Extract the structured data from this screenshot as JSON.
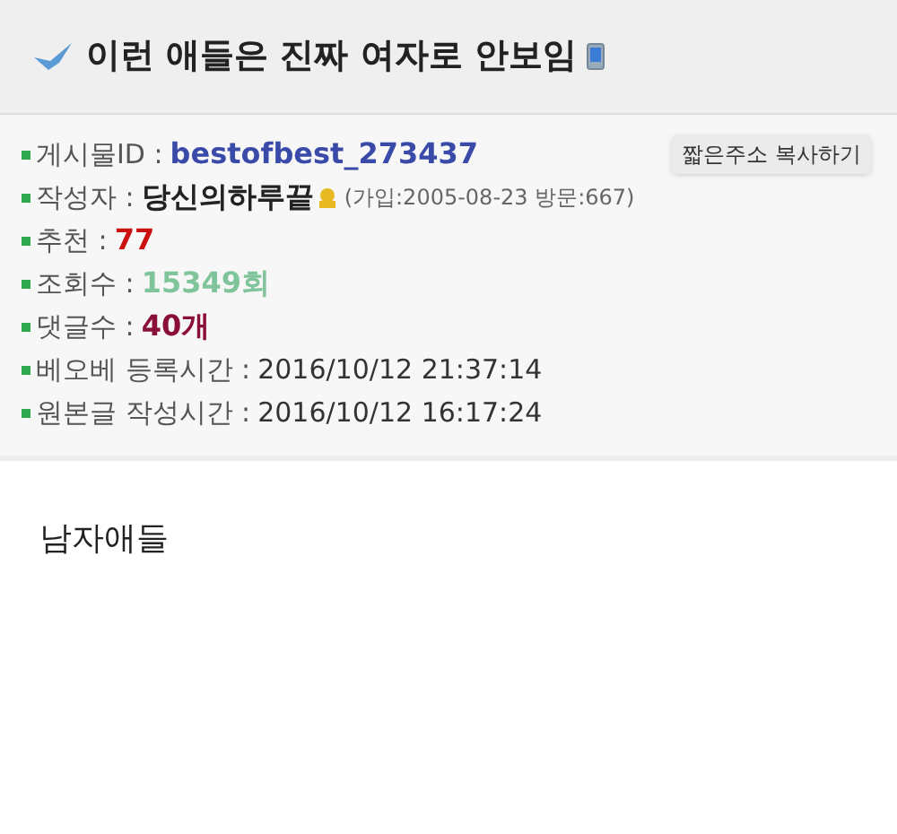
{
  "title": "이런 애들은 진짜 여자로 안보임",
  "copy_button": "짧은주소 복사하기",
  "info": [
    {
      "label": "게시물ID : ",
      "value": "bestofbest_273437",
      "kind": "strong",
      "color": "#3a4aa8"
    },
    {
      "label": "작성자 : ",
      "value": "당신의하루끝",
      "kind": "author",
      "color": "#222222",
      "note": "(가입:2005-08-23 방문:667)"
    },
    {
      "label": "추천 : ",
      "value": "77",
      "kind": "strong",
      "color": "#cc1111"
    },
    {
      "label": "조회수 : ",
      "value": "15349회",
      "kind": "strong",
      "color": "#7fc49a"
    },
    {
      "label": "댓글수 : ",
      "value": "40개",
      "kind": "strong",
      "color": "#8a0f3a"
    },
    {
      "label": "베오베 등록시간 : ",
      "value": "2016/10/12 21:37:14",
      "kind": "plain",
      "color": "#333333"
    },
    {
      "label": "원본글 작성시간 : ",
      "value": "2016/10/12 16:17:24",
      "kind": "plain",
      "color": "#333333"
    }
  ],
  "body": "남자애들"
}
